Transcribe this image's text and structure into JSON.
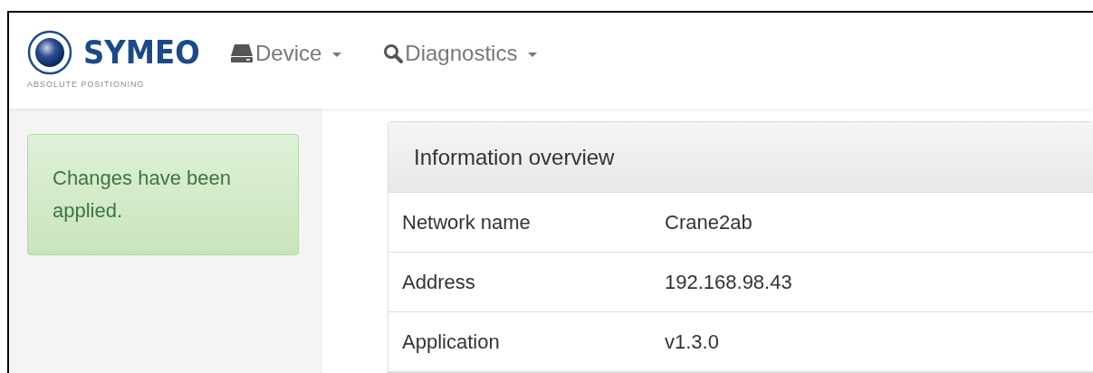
{
  "brand": {
    "name": "SYMEO",
    "tagline": "ABSOLUTE POSITIONING"
  },
  "nav": [
    {
      "label": "Device",
      "kind": "drive"
    },
    {
      "label": "Diagnostics",
      "kind": "search"
    }
  ],
  "alert": {
    "text": "Changes have been applied."
  },
  "panel": {
    "title": "Information overview",
    "rows": [
      {
        "label": "Network name",
        "value": "Crane2ab"
      },
      {
        "label": "Address",
        "value": "192.168.98.43"
      },
      {
        "label": "Application",
        "value": "v1.3.0"
      }
    ]
  }
}
